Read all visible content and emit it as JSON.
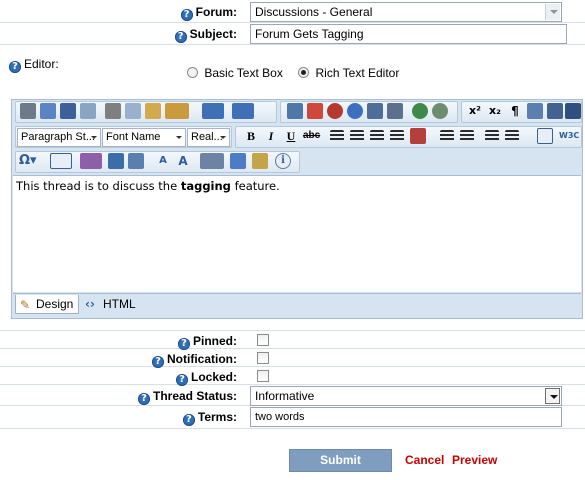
{
  "form": {
    "forum": {
      "label": "Forum:",
      "value": "Discussions - General"
    },
    "subject": {
      "label": "Subject:",
      "value": "Forum Gets Tagging"
    },
    "editor_label": "Editor:",
    "editor_mode": {
      "options": [
        "Basic Text Box",
        "Rich Text Editor"
      ],
      "selected": "Rich Text Editor"
    }
  },
  "toolbar": {
    "paragraph_style": "Paragraph St...",
    "font_name": "Font Name",
    "font_size": "Real..."
  },
  "editor": {
    "content_before": "This thread is to discuss the ",
    "content_bold": "tagging",
    "content_after": " feature.",
    "tabs": [
      "Design",
      "HTML"
    ],
    "active_tab": "Design"
  },
  "options": {
    "pinned": {
      "label": "Pinned:",
      "checked": false
    },
    "notification": {
      "label": "Notification:",
      "checked": false
    },
    "locked": {
      "label": "Locked:",
      "checked": false
    },
    "thread_status": {
      "label": "Thread Status:",
      "value": "Informative"
    },
    "terms": {
      "label": "Terms:",
      "value": "two words"
    }
  },
  "actions": {
    "submit": "Submit",
    "cancel": "Cancel",
    "preview": "Preview"
  },
  "colors": {
    "accent": "#2f6fb8",
    "link": "#cc0000",
    "submit_bg": "#7f9ebf",
    "toolbar_bg": "#d6e4f2"
  }
}
